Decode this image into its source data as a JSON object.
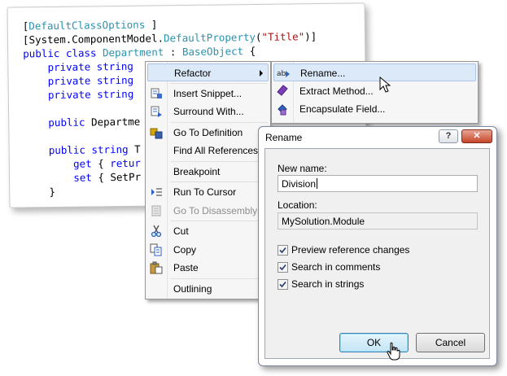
{
  "code": {
    "lines": [
      [
        {
          "t": "[",
          "c": ""
        },
        {
          "t": "DefaultClassOptions",
          "c": "ty"
        },
        {
          "t": " ]",
          "c": ""
        }
      ],
      [
        {
          "t": "[System.ComponentModel.",
          "c": ""
        },
        {
          "t": "DefaultProperty",
          "c": "ty"
        },
        {
          "t": "(",
          "c": ""
        },
        {
          "t": "\"Title\"",
          "c": "st"
        },
        {
          "t": ")]",
          "c": ""
        }
      ],
      [
        {
          "t": "public",
          "c": "kw"
        },
        {
          "t": " ",
          "c": ""
        },
        {
          "t": "class",
          "c": "kw"
        },
        {
          "t": " ",
          "c": ""
        },
        {
          "t": "Department",
          "c": "ty"
        },
        {
          "t": " : ",
          "c": ""
        },
        {
          "t": "BaseObject",
          "c": "ty"
        },
        {
          "t": " {",
          "c": ""
        }
      ],
      [
        {
          "t": "    ",
          "c": ""
        },
        {
          "t": "private",
          "c": "kw"
        },
        {
          "t": " ",
          "c": ""
        },
        {
          "t": "string",
          "c": "kw"
        }
      ],
      [
        {
          "t": "    ",
          "c": ""
        },
        {
          "t": "private",
          "c": "kw"
        },
        {
          "t": " ",
          "c": ""
        },
        {
          "t": "string",
          "c": "kw"
        }
      ],
      [
        {
          "t": "    ",
          "c": ""
        },
        {
          "t": "private",
          "c": "kw"
        },
        {
          "t": " ",
          "c": ""
        },
        {
          "t": "string",
          "c": "kw"
        }
      ],
      [],
      [
        {
          "t": "    ",
          "c": ""
        },
        {
          "t": "public",
          "c": "kw"
        },
        {
          "t": " Departme",
          "c": ""
        }
      ],
      [],
      [
        {
          "t": "    ",
          "c": ""
        },
        {
          "t": "public",
          "c": "kw"
        },
        {
          "t": " ",
          "c": ""
        },
        {
          "t": "string",
          "c": "kw"
        },
        {
          "t": " T",
          "c": ""
        }
      ],
      [
        {
          "t": "        ",
          "c": ""
        },
        {
          "t": "get",
          "c": "kw"
        },
        {
          "t": " { ",
          "c": ""
        },
        {
          "t": "retur",
          "c": "kw"
        }
      ],
      [
        {
          "t": "        ",
          "c": ""
        },
        {
          "t": "set",
          "c": "kw"
        },
        {
          "t": " { SetPr",
          "c": ""
        }
      ],
      [
        {
          "t": "    }",
          "c": ""
        }
      ]
    ]
  },
  "context_menu": {
    "items": [
      {
        "label": "Refactor",
        "icon": "none",
        "submenu": true,
        "highlight": true,
        "disabled": false
      },
      {
        "sep": true
      },
      {
        "label": "Insert Snippet...",
        "icon": "snippet-icon",
        "disabled": false
      },
      {
        "label": "Surround With...",
        "icon": "surround-icon",
        "disabled": false
      },
      {
        "sep": true
      },
      {
        "label": "Go To Definition",
        "icon": "go-to-definition-icon",
        "disabled": false
      },
      {
        "label": "Find All References",
        "icon": "none",
        "disabled": false
      },
      {
        "sep": true
      },
      {
        "label": "Breakpoint",
        "icon": "none",
        "disabled": false
      },
      {
        "sep": true
      },
      {
        "label": "Run To Cursor",
        "icon": "run-to-cursor-icon",
        "disabled": false
      },
      {
        "label": "Go To Disassembly",
        "icon": "disassembly-icon",
        "disabled": true
      },
      {
        "sep": true
      },
      {
        "label": "Cut",
        "icon": "cut-icon",
        "disabled": false
      },
      {
        "label": "Copy",
        "icon": "copy-icon",
        "disabled": false
      },
      {
        "label": "Paste",
        "icon": "paste-icon",
        "disabled": false
      },
      {
        "sep": true
      },
      {
        "label": "Outlining",
        "icon": "none",
        "disabled": false
      }
    ]
  },
  "submenu": {
    "items": [
      {
        "label": "Rename...",
        "icon": "rename-icon",
        "highlight": true
      },
      {
        "label": "Extract Method...",
        "icon": "extract-method-icon",
        "highlight": false
      },
      {
        "label": "Encapsulate Field...",
        "icon": "encapsulate-field-icon",
        "highlight": false
      }
    ]
  },
  "dialog": {
    "title": "Rename",
    "help_button": "?",
    "close_button": "✕",
    "new_name_label": "New name:",
    "new_name_value": "Division",
    "location_label": "Location:",
    "location_value": "MySolution.Module",
    "options": [
      {
        "label": "Preview reference changes",
        "checked": true
      },
      {
        "label": "Search in comments",
        "checked": true
      },
      {
        "label": "Search in strings",
        "checked": true
      }
    ],
    "ok_label": "OK",
    "cancel_label": "Cancel"
  }
}
